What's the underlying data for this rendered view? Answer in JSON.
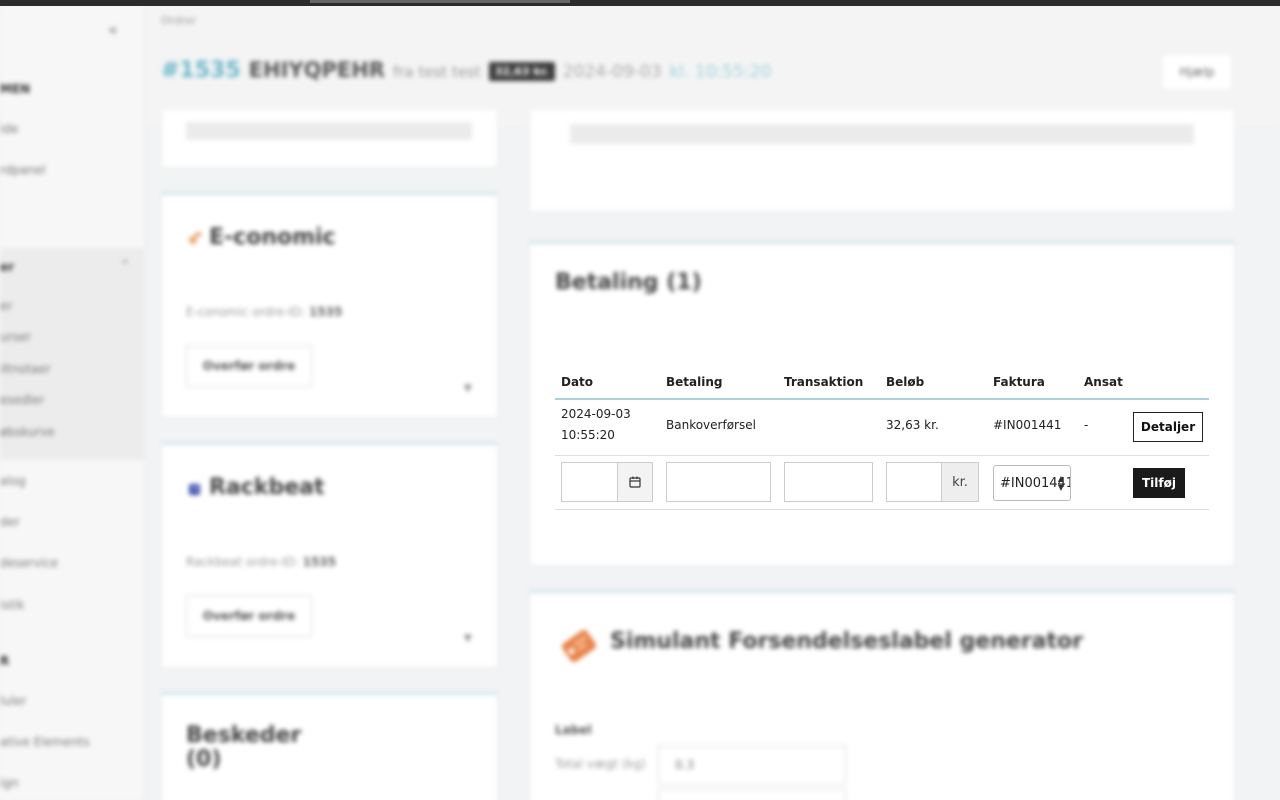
{
  "colors": {
    "accent": "#6bb8c9",
    "card_top": "#cfe6ec",
    "dark_button": "#1a1a1a"
  },
  "sidebar": {
    "collapse_icon": "double-chevron-left-icon",
    "sections": [
      {
        "label": "MEN"
      },
      {
        "label": "er"
      },
      {
        "label": "R"
      }
    ],
    "items": [
      {
        "label": "ide"
      },
      {
        "label": "rdpanel"
      },
      {
        "label": "er"
      },
      {
        "label": "urser"
      },
      {
        "label": "iltnotaer"
      },
      {
        "label": "esedler"
      },
      {
        "label": "øbskurve"
      },
      {
        "label": "alog"
      },
      {
        "label": "der"
      },
      {
        "label": "deservice"
      },
      {
        "label": "istik"
      },
      {
        "label": "luler"
      },
      {
        "label": "ative Elements"
      },
      {
        "label": "ign"
      }
    ]
  },
  "header": {
    "breadcrumb": "Ordrer",
    "order_number": "#1535",
    "order_code": "EHIYQPEHR",
    "from_text": "fra test test",
    "amount_badge": "32,63 kr.",
    "date": "2024-09-03",
    "time_text": "kl. 10:55:20",
    "help_label": "Hjælp"
  },
  "economic": {
    "title": "E-conomic",
    "order_id_label": "E-conomic ordre-ID:",
    "order_id": "1535",
    "transfer_label": "Overfør ordre"
  },
  "rackbeat": {
    "title": "Rackbeat",
    "order_id_label": "Rackbeat ordre-ID:",
    "order_id": "1535",
    "transfer_label": "Overfør ordre"
  },
  "messages": {
    "title_line1": "Beskeder",
    "title_line2": "(0)"
  },
  "payment": {
    "title": "Betaling (1)",
    "headers": [
      "Dato",
      "Betaling",
      "Transaktion",
      "Beløb",
      "Faktura",
      "Ansat"
    ],
    "row": {
      "date_line1": "2024-09-03",
      "date_line2": "10:55:20",
      "method": "Bankoverførsel",
      "transaction": "",
      "amount": "32,63 kr.",
      "invoice": "#IN001441",
      "employee": "-",
      "details_label": "Detaljer"
    },
    "new_row": {
      "currency_addon": "kr.",
      "invoice_selected": "#IN001441",
      "add_label": "Tilføj"
    }
  },
  "shipping_label": {
    "title": "Simulant Forsendelseslabel generator",
    "section_label": "Label",
    "weight_label": "Total vægt (kg)",
    "weight_value": "0.3"
  }
}
